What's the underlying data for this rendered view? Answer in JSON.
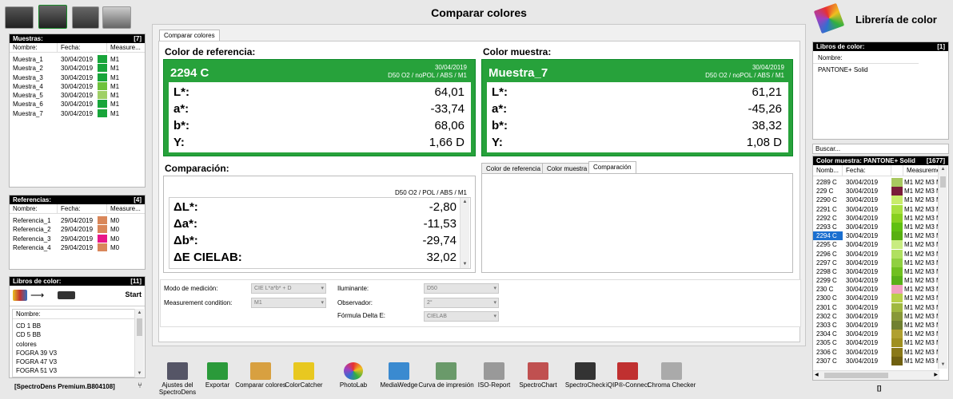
{
  "title": "Comparar colores",
  "library_title": "Librería de color",
  "muestras": {
    "label": "Muestras:",
    "count": "[7]",
    "headers": [
      "Nombre:",
      "Fecha:",
      "Measure..."
    ],
    "rows": [
      {
        "name": "Muestra_1",
        "date": "30/04/2019",
        "m": "M1",
        "color": "#18a53a"
      },
      {
        "name": "Muestra_2",
        "date": "30/04/2019",
        "m": "M1",
        "color": "#18a53a"
      },
      {
        "name": "Muestra_3",
        "date": "30/04/2019",
        "m": "M1",
        "color": "#18a53a"
      },
      {
        "name": "Muestra_4",
        "date": "30/04/2019",
        "m": "M1",
        "color": "#6ec23c"
      },
      {
        "name": "Muestra_5",
        "date": "30/04/2019",
        "m": "M1",
        "color": "#9fd066"
      },
      {
        "name": "Muestra_6",
        "date": "30/04/2019",
        "m": "M1",
        "color": "#18a53a"
      },
      {
        "name": "Muestra_7",
        "date": "30/04/2019",
        "m": "M1",
        "color": "#18a53a"
      }
    ]
  },
  "referencias": {
    "label": "Referencias:",
    "count": "[4]",
    "headers": [
      "Nombre:",
      "Fecha:",
      "Measure..."
    ],
    "rows": [
      {
        "name": "Referencia_1",
        "date": "29/04/2019",
        "m": "M0",
        "color": "#d9875a"
      },
      {
        "name": "Referencia_2",
        "date": "29/04/2019",
        "m": "M0",
        "color": "#d9875a"
      },
      {
        "name": "Referencia_3",
        "date": "29/04/2019",
        "m": "M0",
        "color": "#e8178a"
      },
      {
        "name": "Referencia_4",
        "date": "29/04/2019",
        "m": "M0",
        "color": "#d9875a"
      }
    ]
  },
  "libros_left": {
    "label": "Libros de color:",
    "count": "[11]",
    "start": "Start",
    "header": "Nombre:",
    "rows": [
      "CD 1 BB",
      "CD 5 BB",
      "colores",
      "FOGRA 39 V3",
      "FOGRA 47 V3",
      "FOGRA 51 V3"
    ]
  },
  "device_label": "[SpectroDens Premium.B804108]",
  "tab_main": "Comparar colores",
  "ref": {
    "section": "Color de referencia:",
    "name": "2294 C",
    "date": "30/04/2019",
    "cond": "D50 O2 / noPOL / ABS / M1",
    "values": [
      {
        "k": "L*:",
        "v": "64,01"
      },
      {
        "k": "a*:",
        "v": "-33,74"
      },
      {
        "k": "b*:",
        "v": "68,06"
      },
      {
        "k": "Y:",
        "v": "1,66 D"
      }
    ]
  },
  "sample": {
    "section": "Color muestra:",
    "name": "Muestra_7",
    "date": "30/04/2019",
    "cond": "D50 O2 / noPOL / ABS / M1",
    "values": [
      {
        "k": "L*:",
        "v": "61,21"
      },
      {
        "k": "a*:",
        "v": "-45,26"
      },
      {
        "k": "b*:",
        "v": "38,32"
      },
      {
        "k": "Y:",
        "v": "1,08 D"
      }
    ]
  },
  "comp": {
    "section": "Comparación:",
    "cond": "D50 O2 / POL / ABS / M1",
    "values": [
      {
        "k": "ΔL*:",
        "v": "-2,80"
      },
      {
        "k": "Δa*:",
        "v": "-11,53"
      },
      {
        "k": "Δb*:",
        "v": "-29,74"
      },
      {
        "k": "ΔE CIELAB:",
        "v": "32,02"
      }
    ]
  },
  "subtabs": [
    "Color de referencia",
    "Color muestra",
    "Comparación"
  ],
  "form": {
    "modo_label": "Modo de medición:",
    "modo_value": "CIE L*a*b* + D",
    "cond_label": "Measurement condition:",
    "cond_value": "M1",
    "ilum_label": "Iluminante:",
    "ilum_value": "D50",
    "obs_label": "Observador:",
    "obs_value": "2°",
    "delta_label": "Fórmula Delta E:",
    "delta_value": "CIELAB"
  },
  "toolbar": [
    {
      "label": "Ajustes del SpectroDens",
      "color": "#556"
    },
    {
      "label": "Exportar",
      "color": "#2a9a3a"
    },
    {
      "label": "Comparar colores",
      "color": "#d8a040"
    },
    {
      "label": "ColorCatcher",
      "color": "#e8c820"
    },
    {
      "label": "PhotoLab",
      "color": "#d04aa0"
    },
    {
      "label": "MediaWedge",
      "color": "#3a8ad0"
    },
    {
      "label": "Curva de impresión",
      "color": "#6a9a6a"
    },
    {
      "label": "ISO-Report",
      "color": "#999"
    },
    {
      "label": "SpectroChart",
      "color": "#c05050"
    },
    {
      "label": "SpectroCheck",
      "color": "#333"
    },
    {
      "label": "iQIP®-Connect",
      "color": "#c03030"
    },
    {
      "label": "Chroma Checker",
      "color": "#aaa"
    }
  ],
  "libros_right": {
    "label": "Libros de color:",
    "count": "[1]",
    "header": "Nombre:",
    "rows": [
      "PANTONE+ Solid"
    ]
  },
  "search_label": "Buscar...",
  "pantone": {
    "label": "Color muestra: PANTONE+ Solid",
    "count": "[1677]",
    "headers": [
      "Nomb...",
      "Fecha:",
      "Measurement c"
    ],
    "rows": [
      {
        "name": "2289 C",
        "date": "30/04/2019",
        "color": "#a8c860",
        "m": "M1 M2 M3 M0"
      },
      {
        "name": "229 C",
        "date": "30/04/2019",
        "color": "#7a1c3a",
        "m": "M1 M2 M3 M0"
      },
      {
        "name": "2290 C",
        "date": "30/04/2019",
        "color": "#c8ec6a",
        "m": "M1 M2 M3 M0"
      },
      {
        "name": "2291 C",
        "date": "30/04/2019",
        "color": "#a8e040",
        "m": "M1 M2 M3 M0"
      },
      {
        "name": "2292 C",
        "date": "30/04/2019",
        "color": "#88d020",
        "m": "M1 M2 M3 M0"
      },
      {
        "name": "2293 C",
        "date": "30/04/2019",
        "color": "#60c010",
        "m": "M1 M2 M3 M0"
      },
      {
        "name": "2294 C",
        "date": "30/04/2019",
        "color": "#58b010",
        "m": "M1 M2 M3 M0",
        "sel": true
      },
      {
        "name": "2295 C",
        "date": "30/04/2019",
        "color": "#c8ec80",
        "m": "M1 M2 M3 M0"
      },
      {
        "name": "2296 C",
        "date": "30/04/2019",
        "color": "#b0e060",
        "m": "M1 M2 M3 M0"
      },
      {
        "name": "2297 C",
        "date": "30/04/2019",
        "color": "#90d040",
        "m": "M1 M2 M3 M0"
      },
      {
        "name": "2298 C",
        "date": "30/04/2019",
        "color": "#70c020",
        "m": "M1 M2 M3 M0"
      },
      {
        "name": "2299 C",
        "date": "30/04/2019",
        "color": "#58b018",
        "m": "M1 M2 M3 M0"
      },
      {
        "name": "230 C",
        "date": "30/04/2019",
        "color": "#f0a0c0",
        "m": "M1 M2 M3 M0"
      },
      {
        "name": "2300 C",
        "date": "30/04/2019",
        "color": "#b8d048",
        "m": "M1 M2 M3 M0"
      },
      {
        "name": "2301 C",
        "date": "30/04/2019",
        "color": "#a0b840",
        "m": "M1 M2 M3 M0"
      },
      {
        "name": "2302 C",
        "date": "30/04/2019",
        "color": "#889838",
        "m": "M1 M2 M3 M0"
      },
      {
        "name": "2303 C",
        "date": "30/04/2019",
        "color": "#708030",
        "m": "M1 M2 M3 M0"
      },
      {
        "name": "2304 C",
        "date": "30/04/2019",
        "color": "#b0a030",
        "m": "M1 M2 M3 M0"
      },
      {
        "name": "2305 C",
        "date": "30/04/2019",
        "color": "#a09020",
        "m": "M1 M2 M3 M0"
      },
      {
        "name": "2306 C",
        "date": "30/04/2019",
        "color": "#8a7818",
        "m": "M1 M2 M3 M0"
      },
      {
        "name": "2307 C",
        "date": "30/04/2019",
        "color": "#706010",
        "m": "M1 M2 M3 M0"
      }
    ]
  },
  "bottom_right": "[]",
  "colors": {
    "green_dark": "#27a23b",
    "green_frame": "#0f8a2a",
    "selection": "#1a6fd0"
  }
}
